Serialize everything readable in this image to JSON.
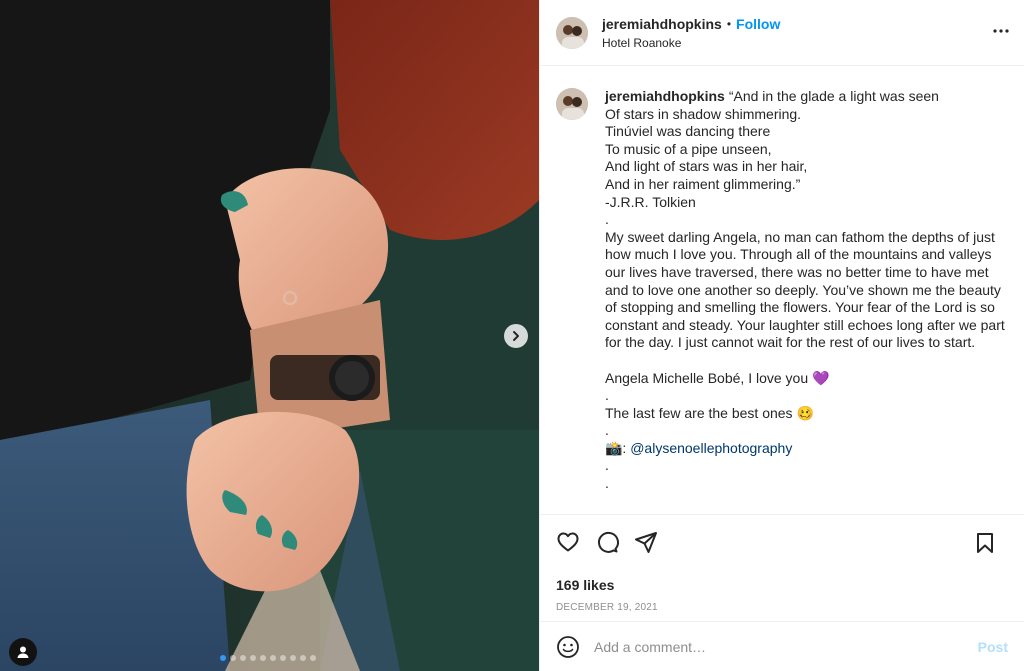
{
  "post": {
    "username": "jeremiahdhopkins",
    "separator": "•",
    "follow_label": "Follow",
    "location": "Hotel Roanoke",
    "more_icon": "more-horizontal-icon",
    "photo_alt": "Couple holding hands, woman in red sweater with engagement ring, man with watch",
    "carousel": {
      "total": 10,
      "active_index": 0
    }
  },
  "caption": {
    "username": "jeremiahdhopkins",
    "lines": [
      "“And in the glade a light was seen",
      "Of stars in shadow shimmering.",
      "Tinúviel was dancing there",
      "To music of a pipe unseen,",
      "And light of stars was in her hair,",
      "And in her raiment glimmering.”",
      "-J.R.R. Tolkien",
      ".",
      "My sweet darling Angela, no man can fathom the depths of just how much I love you. Through all of the mountains and valleys our lives have traversed, there was no better time to have met and to love one another so deeply. You’ve shown me the beauty of stopping and smelling the flowers. Your fear of the Lord is so constant and steady. Your laughter still echoes long after we part for the day. I just cannot wait for the rest of our lives to start.",
      "",
      "Angela Michelle Bobé, I love you 💜",
      ".",
      "The last few are the best ones 🥴",
      ".",
      "📸: @alysenoellephotography",
      ".",
      "."
    ],
    "camera_emoji": "📸:",
    "mention": "@alysenoellephotography"
  },
  "actions": {
    "like_icon": "heart-outline-icon",
    "comment_icon": "comment-bubble-icon",
    "share_icon": "paper-plane-icon",
    "save_icon": "bookmark-icon",
    "likes": "169 likes",
    "date": "DECEMBER 19, 2021"
  },
  "comment_box": {
    "emoji_icon": "smiley-icon",
    "placeholder": "Add a comment…",
    "post_label": "Post"
  },
  "colors": {
    "link_blue": "#0095f6",
    "post_disabled": "#b2dffc",
    "border": "#efefef",
    "text": "#262626",
    "muted": "#8e8e8e",
    "mention": "#00376b"
  }
}
